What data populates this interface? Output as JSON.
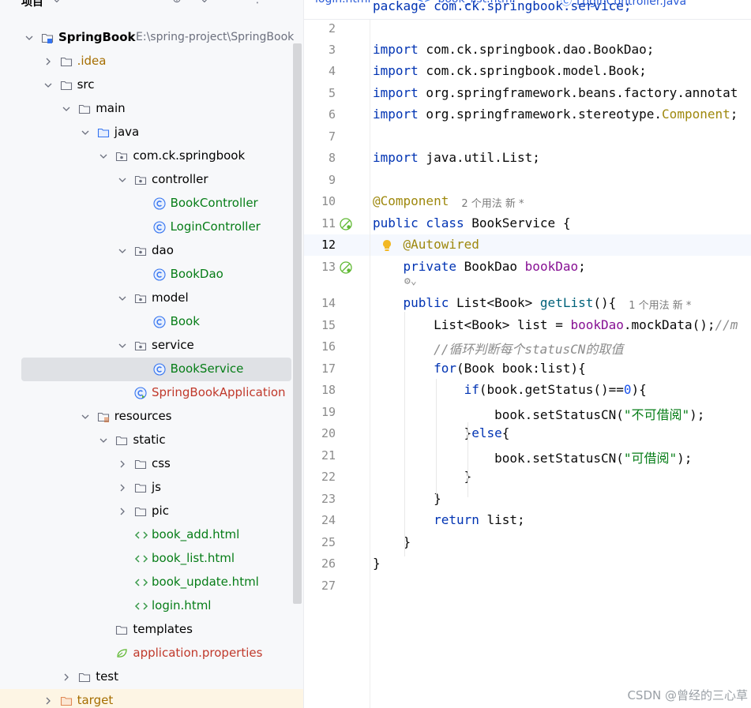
{
  "project_panel": {
    "title": "项目",
    "tree": [
      {
        "label": "SpringBook",
        "path": "E:\\spring-project\\SpringBook",
        "depth": 0,
        "expanded": true,
        "icon": "module-folder-icon",
        "style": "bold"
      },
      {
        "label": ".idea",
        "depth": 1,
        "expanded": false,
        "icon": "folder-icon",
        "style": "idea"
      },
      {
        "label": "src",
        "depth": 1,
        "expanded": true,
        "icon": "folder-icon",
        "style": ""
      },
      {
        "label": "main",
        "depth": 2,
        "expanded": true,
        "icon": "folder-icon",
        "style": ""
      },
      {
        "label": "java",
        "depth": 3,
        "expanded": true,
        "icon": "source-folder-icon",
        "style": ""
      },
      {
        "label": "com.ck.springbook",
        "depth": 4,
        "expanded": true,
        "icon": "package-icon",
        "style": ""
      },
      {
        "label": "controller",
        "depth": 5,
        "expanded": true,
        "icon": "package-icon",
        "style": ""
      },
      {
        "label": "BookController",
        "depth": 6,
        "leaf": true,
        "icon": "class-icon",
        "style": "green"
      },
      {
        "label": "LoginController",
        "depth": 6,
        "leaf": true,
        "icon": "class-icon",
        "style": "green"
      },
      {
        "label": "dao",
        "depth": 5,
        "expanded": true,
        "icon": "package-icon",
        "style": ""
      },
      {
        "label": "BookDao",
        "depth": 6,
        "leaf": true,
        "icon": "class-icon",
        "style": "green"
      },
      {
        "label": "model",
        "depth": 5,
        "expanded": true,
        "icon": "package-icon",
        "style": ""
      },
      {
        "label": "Book",
        "depth": 6,
        "leaf": true,
        "icon": "class-icon",
        "style": "green"
      },
      {
        "label": "service",
        "depth": 5,
        "expanded": true,
        "icon": "package-icon",
        "style": ""
      },
      {
        "label": "BookService",
        "depth": 6,
        "leaf": true,
        "icon": "class-icon",
        "style": "green",
        "selected": true
      },
      {
        "label": "SpringBookApplication",
        "depth": 5,
        "leaf": true,
        "icon": "spring-app-icon",
        "style": "red"
      },
      {
        "label": "resources",
        "depth": 3,
        "expanded": true,
        "icon": "resources-folder-icon",
        "style": ""
      },
      {
        "label": "static",
        "depth": 4,
        "expanded": true,
        "icon": "folder-icon",
        "style": ""
      },
      {
        "label": "css",
        "depth": 5,
        "expanded": false,
        "icon": "folder-icon",
        "style": ""
      },
      {
        "label": "js",
        "depth": 5,
        "expanded": false,
        "icon": "folder-icon",
        "style": ""
      },
      {
        "label": "pic",
        "depth": 5,
        "expanded": false,
        "icon": "folder-icon",
        "style": ""
      },
      {
        "label": "book_add.html",
        "depth": 5,
        "leaf": true,
        "icon": "html-icon",
        "style": "green"
      },
      {
        "label": "book_list.html",
        "depth": 5,
        "leaf": true,
        "icon": "html-icon",
        "style": "green"
      },
      {
        "label": "book_update.html",
        "depth": 5,
        "leaf": true,
        "icon": "html-icon",
        "style": "green"
      },
      {
        "label": "login.html",
        "depth": 5,
        "leaf": true,
        "icon": "html-icon",
        "style": "green"
      },
      {
        "label": "templates",
        "depth": 4,
        "leaf": true,
        "icon": "folder-icon",
        "style": ""
      },
      {
        "label": "application.properties",
        "depth": 4,
        "leaf": true,
        "icon": "spring-properties-icon",
        "style": "red"
      },
      {
        "label": "test",
        "depth": 2,
        "expanded": false,
        "icon": "folder-icon",
        "style": ""
      },
      {
        "label": "target",
        "depth": 1,
        "expanded": false,
        "icon": "excluded-folder-icon",
        "style": "target"
      }
    ]
  },
  "editor": {
    "tabs": [
      {
        "label": "login.html",
        "icon": "html-icon"
      },
      {
        "label": "book_list.html",
        "icon": "html-icon"
      },
      {
        "label": "LoginController.java",
        "icon": "class-icon"
      }
    ],
    "current_line": 12,
    "lines": [
      {
        "n": "",
        "tokens": [
          {
            "t": "package com.ck.springbook.service;",
            "c": "kw"
          }
        ]
      },
      {
        "n": "2",
        "tokens": []
      },
      {
        "n": "3",
        "tokens": [
          {
            "t": "import",
            "c": "kw"
          },
          {
            "t": " com.ck.springbook.dao.BookDao;",
            "c": ""
          }
        ]
      },
      {
        "n": "4",
        "tokens": [
          {
            "t": "import",
            "c": "kw"
          },
          {
            "t": " com.ck.springbook.model.Book;",
            "c": ""
          }
        ]
      },
      {
        "n": "5",
        "tokens": [
          {
            "t": "import",
            "c": "kw"
          },
          {
            "t": " org.springframework.beans.factory.annotat",
            "c": ""
          }
        ]
      },
      {
        "n": "6",
        "tokens": [
          {
            "t": "import",
            "c": "kw"
          },
          {
            "t": " org.springframework.stereotype.",
            "c": ""
          },
          {
            "t": "Component",
            "c": "ann"
          },
          {
            "t": ";",
            "c": ""
          }
        ]
      },
      {
        "n": "7",
        "tokens": []
      },
      {
        "n": "8",
        "tokens": [
          {
            "t": "import",
            "c": "kw"
          },
          {
            "t": " java.util.List;",
            "c": ""
          }
        ]
      },
      {
        "n": "9",
        "tokens": []
      },
      {
        "n": "10",
        "tokens": [
          {
            "t": "@Component",
            "c": "ann"
          }
        ],
        "hint": "2 个用法   新 *"
      },
      {
        "n": "11",
        "tokens": [
          {
            "t": "public class",
            "c": "kw"
          },
          {
            "t": " BookService {",
            "c": ""
          }
        ],
        "gutter": "bean-icon"
      },
      {
        "n": "12",
        "tokens": [
          {
            "t": "    ",
            "c": ""
          },
          {
            "t": "@Autowired",
            "c": "ann"
          }
        ],
        "gutter": "bulb-icon",
        "current": true
      },
      {
        "n": "13",
        "tokens": [
          {
            "t": "    ",
            "c": ""
          },
          {
            "t": "private",
            "c": "kw"
          },
          {
            "t": " BookDao ",
            "c": ""
          },
          {
            "t": "bookDao",
            "c": "fld"
          },
          {
            "t": ";",
            "c": ""
          }
        ],
        "gutter": "bean-icon"
      },
      {
        "n": "",
        "tokens": [],
        "inlay": true
      },
      {
        "n": "14",
        "tokens": [
          {
            "t": "    ",
            "c": ""
          },
          {
            "t": "public",
            "c": "kw"
          },
          {
            "t": " List<Book> ",
            "c": ""
          },
          {
            "t": "getList",
            "c": "fn"
          },
          {
            "t": "(){",
            "c": ""
          }
        ],
        "hint": "1 个用法   新 *"
      },
      {
        "n": "15",
        "tokens": [
          {
            "t": "        List<Book> list = ",
            "c": ""
          },
          {
            "t": "bookDao",
            "c": "fld"
          },
          {
            "t": ".mockData();",
            "c": ""
          },
          {
            "t": "//m",
            "c": "cmt"
          }
        ]
      },
      {
        "n": "16",
        "tokens": [
          {
            "t": "        ",
            "c": ""
          },
          {
            "t": "//循环判断每个statusCN的取值",
            "c": "cmt"
          }
        ]
      },
      {
        "n": "17",
        "tokens": [
          {
            "t": "        ",
            "c": ""
          },
          {
            "t": "for",
            "c": "kw"
          },
          {
            "t": "(Book book:list){",
            "c": ""
          }
        ]
      },
      {
        "n": "18",
        "tokens": [
          {
            "t": "            ",
            "c": ""
          },
          {
            "t": "if",
            "c": "kw"
          },
          {
            "t": "(book.getStatus()==",
            "c": ""
          },
          {
            "t": "0",
            "c": "num"
          },
          {
            "t": "){",
            "c": ""
          }
        ]
      },
      {
        "n": "19",
        "tokens": [
          {
            "t": "                book.setStatusCN(",
            "c": ""
          },
          {
            "t": "\"不可借阅\"",
            "c": "str"
          },
          {
            "t": ");",
            "c": ""
          }
        ]
      },
      {
        "n": "20",
        "tokens": [
          {
            "t": "            }",
            "c": ""
          },
          {
            "t": "else",
            "c": "kw"
          },
          {
            "t": "{",
            "c": ""
          }
        ]
      },
      {
        "n": "21",
        "tokens": [
          {
            "t": "                book.setStatusCN(",
            "c": ""
          },
          {
            "t": "\"可借阅\"",
            "c": "str"
          },
          {
            "t": ");",
            "c": ""
          }
        ]
      },
      {
        "n": "22",
        "tokens": [
          {
            "t": "            }",
            "c": ""
          }
        ]
      },
      {
        "n": "23",
        "tokens": [
          {
            "t": "        }",
            "c": ""
          }
        ]
      },
      {
        "n": "24",
        "tokens": [
          {
            "t": "        ",
            "c": ""
          },
          {
            "t": "return",
            "c": "kw"
          },
          {
            "t": " list;",
            "c": ""
          }
        ]
      },
      {
        "n": "25",
        "tokens": [
          {
            "t": "    }",
            "c": ""
          }
        ]
      },
      {
        "n": "26",
        "tokens": [
          {
            "t": "}",
            "c": ""
          }
        ]
      },
      {
        "n": "27",
        "tokens": []
      }
    ]
  },
  "watermark": "CSDN @曾经的三心草",
  "colors": {
    "keyword": "#0033b3",
    "annotation": "#9e880d",
    "string": "#067d17",
    "number": "#1750eb",
    "field": "#871094",
    "method": "#00627a",
    "comment": "#8c8c8c",
    "tree_green": "#067d17",
    "tree_red": "#c0392b",
    "selected_row": "#dfe1e5"
  }
}
